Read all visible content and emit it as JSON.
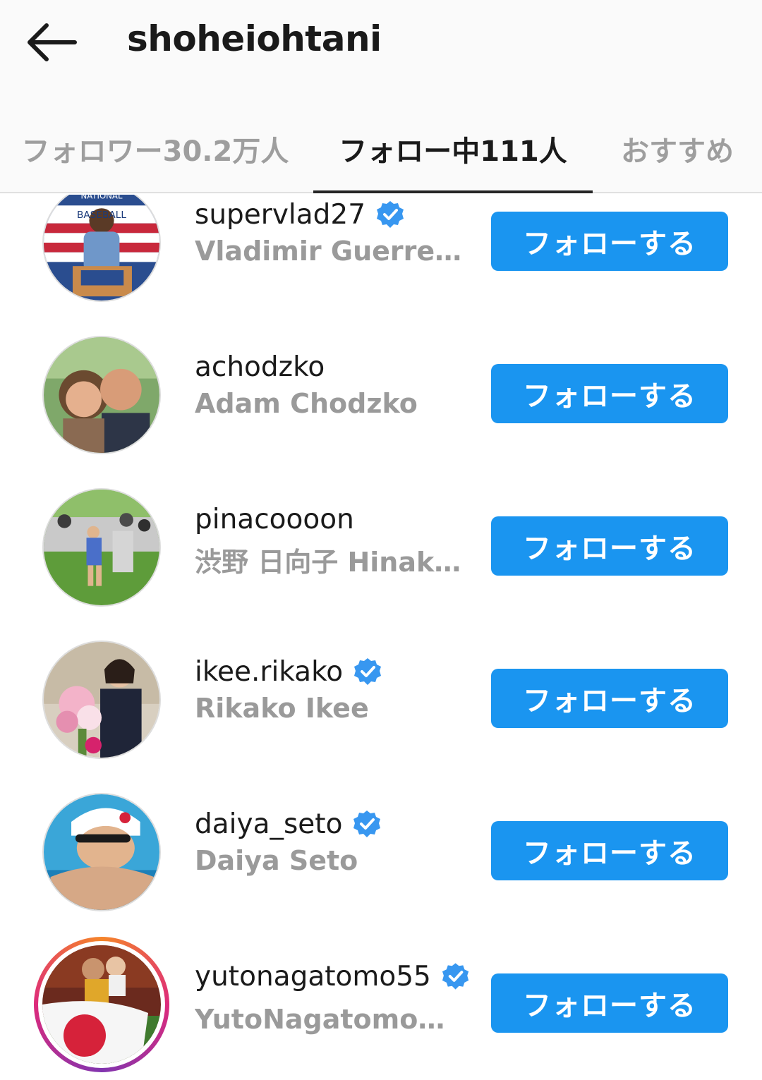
{
  "header": {
    "title": "shoheiohtani",
    "back_icon": "arrow-left-icon"
  },
  "tabs": [
    {
      "label": "フォロワー30.2万人",
      "active": false
    },
    {
      "label": "フォロー中111人",
      "active": true
    },
    {
      "label": "おすすめ",
      "active": false
    }
  ],
  "colors": {
    "follow_button": "#1a95f0",
    "verified_badge": "#3897f0",
    "active_tab_underline": "#262626"
  },
  "users": [
    {
      "username": "supervlad27",
      "full_name": "Vladimir Guerrero",
      "verified": true,
      "button_label": "フォローする",
      "avatar": "hall-of-fame-speaker-photo"
    },
    {
      "username": "achodzko",
      "full_name": "Adam Chodzko",
      "verified": false,
      "button_label": "フォローする",
      "avatar": "couple-selfie-photo"
    },
    {
      "username": "pinacoooon",
      "full_name": "渋野 日向子  Hinak…",
      "verified": false,
      "button_label": "フォローする",
      "avatar": "golfer-crowd-photo"
    },
    {
      "username": "ikee.rikako",
      "full_name": "Rikako Ikee",
      "verified": true,
      "button_label": "フォローする",
      "avatar": "flower-bouquet-photo"
    },
    {
      "username": "daiya_seto",
      "full_name": "Daiya Seto",
      "verified": true,
      "button_label": "フォローする",
      "avatar": "swimmer-photo"
    },
    {
      "username": "yutonagatomo55",
      "full_name": "YutoNagatomo　…",
      "verified": true,
      "button_label": "フォローする",
      "avatar": "soccer-flag-photo",
      "story_ring": true
    }
  ]
}
